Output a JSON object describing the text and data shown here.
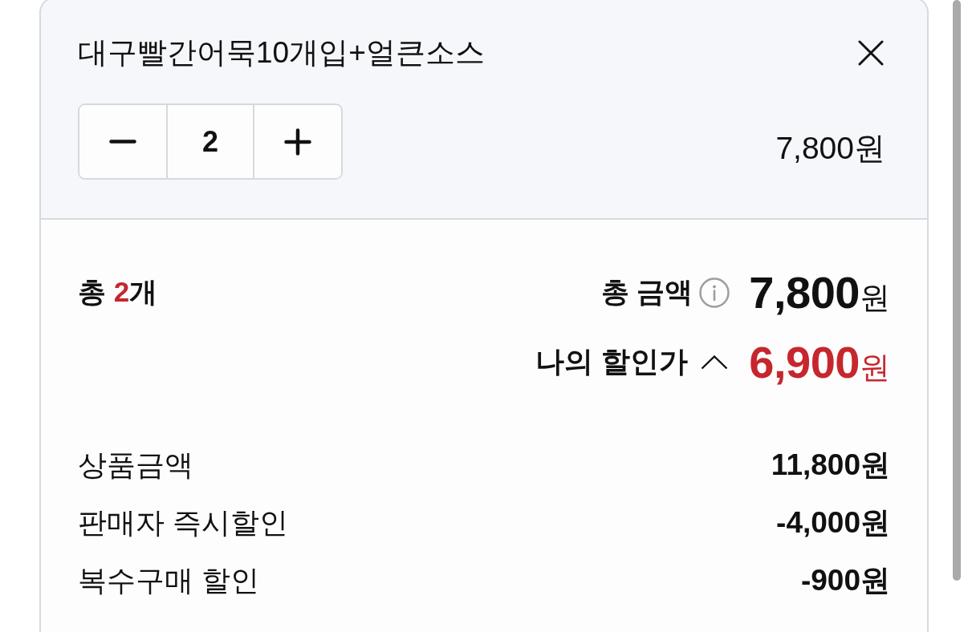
{
  "item": {
    "name": "대구빨간어묵10개입+얼큰소스",
    "quantity": "2",
    "price": "7,800원"
  },
  "summary": {
    "count": {
      "prefix": "총 ",
      "value": "2",
      "suffix": "개"
    },
    "total": {
      "label": "총 금액",
      "amount": "7,800",
      "unit": "원"
    },
    "discount": {
      "label": "나의 할인가",
      "expanded": true,
      "amount": "6,900",
      "unit": "원"
    },
    "breakdown": [
      {
        "label": "상품금액",
        "value": "11,800원"
      },
      {
        "label": "판매자 즉시할인",
        "value": "-4,000원"
      },
      {
        "label": "복수구매 할인",
        "value": "-900원"
      }
    ]
  }
}
